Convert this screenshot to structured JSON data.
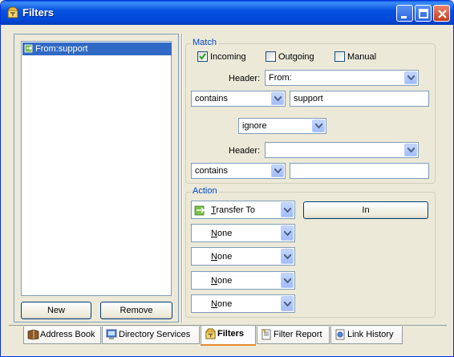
{
  "window": {
    "title": "Filters"
  },
  "filters_list": {
    "items": [
      {
        "label": "From:support"
      }
    ]
  },
  "buttons": {
    "new_label": "New",
    "remove_label": "Remove",
    "in_label": "In"
  },
  "match": {
    "group_label": "Match",
    "incoming_label": "Incoming",
    "incoming_checked": true,
    "outgoing_label": "Outgoing",
    "outgoing_checked": false,
    "manual_label": "Manual",
    "manual_checked": false,
    "header1_label": "Header:",
    "header1_value": "From:",
    "condition1_value": "contains",
    "value1": "support",
    "conjunction_value": "ignore",
    "header2_label": "Header:",
    "header2_value": "",
    "condition2_value": "contains",
    "value2": ""
  },
  "action": {
    "group_label": "Action",
    "action1": "Transfer To",
    "action1_accel": "T",
    "action1_rest": "ransfer To",
    "none_accel": "N",
    "none_rest": "one",
    "others": [
      "None",
      "None",
      "None",
      "None"
    ]
  },
  "tabs": [
    {
      "label": "Address Book",
      "icon": "address-book-icon"
    },
    {
      "label": "Directory Services",
      "icon": "directory-services-icon"
    },
    {
      "label": "Filters",
      "icon": "filters-icon",
      "active": true
    },
    {
      "label": "Filter Report",
      "icon": "filter-report-icon"
    },
    {
      "label": "Link History",
      "icon": "link-history-icon"
    }
  ],
  "colors": {
    "titlebar": "#0553e0",
    "selection": "#316ac5",
    "group_label": "#0046d5",
    "active_tab_accent": "#e68b2c"
  }
}
